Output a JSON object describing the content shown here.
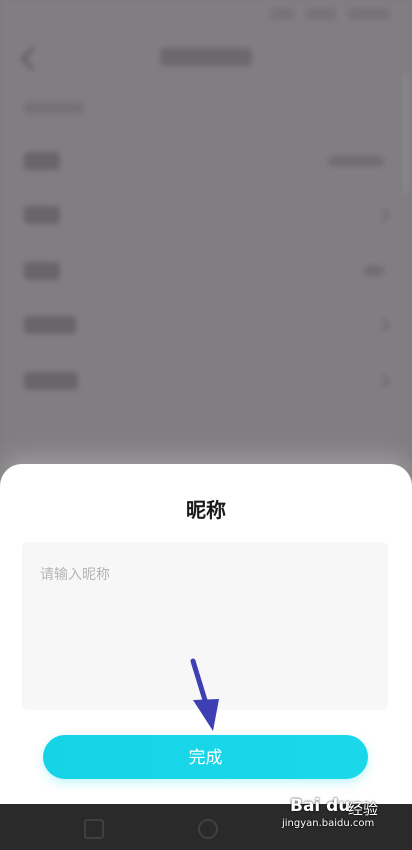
{
  "sheet": {
    "title": "昵称",
    "input": {
      "value": "",
      "placeholder": "请输入昵称"
    },
    "done_label": "完成"
  },
  "watermark": {
    "brand": "Bai du",
    "name": "经验",
    "url": "jingyan.baidu.com"
  },
  "colors": {
    "accent": "#1ad8ea",
    "annotation_arrow": "#3d3fb3"
  }
}
